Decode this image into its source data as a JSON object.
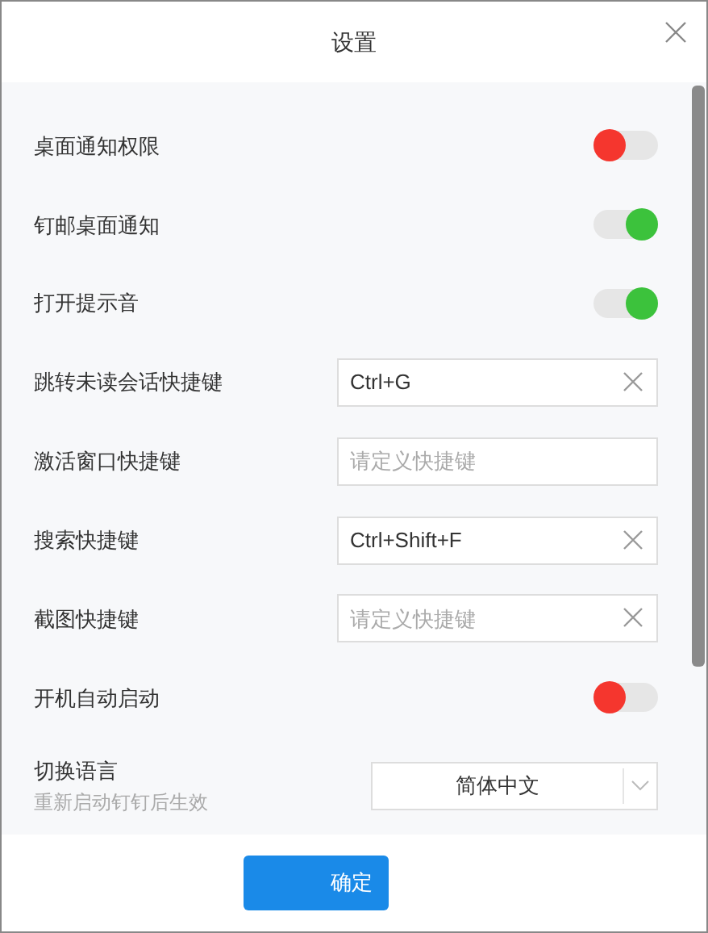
{
  "title": "设置",
  "rows": [
    {
      "kind": "toggle",
      "label": "桌面通知权限",
      "on": false
    },
    {
      "kind": "toggle",
      "label": "钉邮桌面通知",
      "on": true
    },
    {
      "kind": "toggle",
      "label": "打开提示音",
      "on": true
    },
    {
      "kind": "field",
      "label": "跳转未读会话快捷键",
      "value": "Ctrl+G",
      "clearable": true
    },
    {
      "kind": "field",
      "label": "激活窗口快捷键",
      "placeholder": "请定义快捷键",
      "clearable": false
    },
    {
      "kind": "field",
      "label": "搜索快捷键",
      "value": "Ctrl+Shift+F",
      "clearable": true
    },
    {
      "kind": "field",
      "label": "截图快捷键",
      "placeholder": "请定义快捷键",
      "clearable": true
    },
    {
      "kind": "toggle",
      "label": "开机自动启动",
      "on": false
    },
    {
      "kind": "select",
      "label": "切换语言",
      "hint": "重新启动钉钉后生效",
      "value": "简体中文"
    }
  ],
  "confirm_button": "确定"
}
